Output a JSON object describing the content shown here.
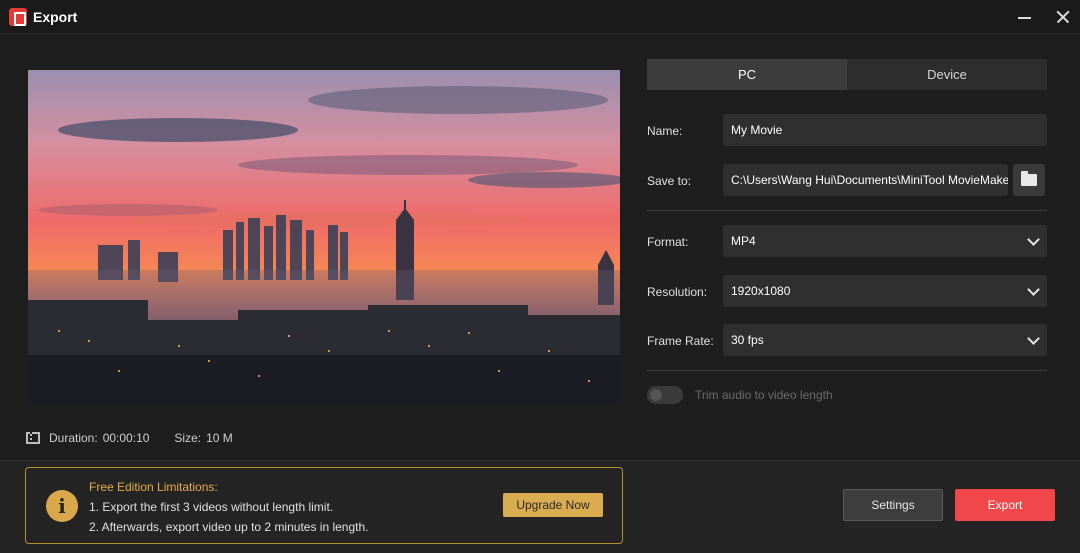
{
  "window": {
    "title": "Export"
  },
  "preview": {
    "duration_label": "Duration:",
    "duration": "00:00:10",
    "size_label": "Size:",
    "size": "10 M"
  },
  "tabs": [
    {
      "label": "PC",
      "active": true
    },
    {
      "label": "Device",
      "active": false
    }
  ],
  "form": {
    "name": {
      "label": "Name:",
      "value": "My Movie"
    },
    "save_to": {
      "label": "Save to:",
      "value": "C:\\Users\\Wang Hui\\Documents\\MiniTool MovieMaker"
    },
    "format": {
      "label": "Format:",
      "value": "MP4"
    },
    "resolution": {
      "label": "Resolution:",
      "value": "1920x1080"
    },
    "frame_rate": {
      "label": "Frame Rate:",
      "value": "30 fps"
    },
    "trim_audio": {
      "label": "Trim audio to video length",
      "enabled": false
    }
  },
  "limitations": {
    "title": "Free Edition Limitations:",
    "line1": "1. Export the first 3 videos without length limit.",
    "line2": "2. Afterwards, export video up to 2 minutes in length.",
    "upgrade_label": "Upgrade Now"
  },
  "actions": {
    "settings_label": "Settings",
    "export_label": "Export"
  },
  "colors": {
    "accent_export": "#f2474a",
    "accent_upgrade": "#d9ac4f",
    "limitation_border": "#b8902f"
  },
  "icons": [
    "app-logo-icon",
    "minimize-icon",
    "close-icon",
    "film-icon",
    "folder-icon",
    "chevron-down-icon",
    "info-icon"
  ]
}
